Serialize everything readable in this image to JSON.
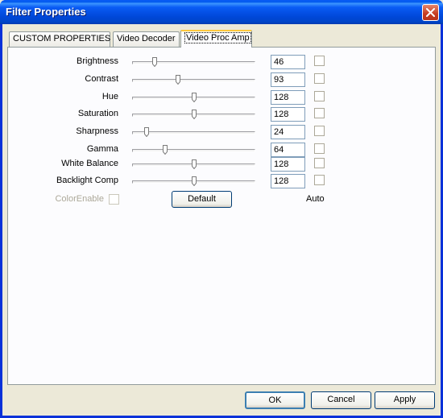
{
  "window": {
    "title": "Filter Properties"
  },
  "tabs": [
    {
      "label": "CUSTOM PROPERTIES",
      "active": false
    },
    {
      "label": "Video Decoder",
      "active": false
    },
    {
      "label": "Video Proc Amp",
      "active": true
    }
  ],
  "controls": [
    {
      "label": "Brightness",
      "value": "46",
      "slider_fraction": 0.17
    },
    {
      "label": "Contrast",
      "value": "93",
      "slider_fraction": 0.37
    },
    {
      "label": "Hue",
      "value": "128",
      "slider_fraction": 0.5
    },
    {
      "label": "Saturation",
      "value": "128",
      "slider_fraction": 0.5
    },
    {
      "label": "Sharpness",
      "value": "24",
      "slider_fraction": 0.1
    },
    {
      "label": "Gamma",
      "value": "64",
      "slider_fraction": 0.26
    },
    {
      "label": "White Balance",
      "value": "128",
      "slider_fraction": 0.5
    },
    {
      "label": "Backlight Comp",
      "value": "128",
      "slider_fraction": 0.5
    }
  ],
  "color_enable": {
    "label": "ColorEnable",
    "checked": false,
    "enabled": false
  },
  "default_button": "Default",
  "auto_label": "Auto",
  "footer": {
    "ok": "OK",
    "cancel": "Cancel",
    "apply": "Apply"
  },
  "icons": {
    "close": "close-icon"
  },
  "colors": {
    "titlebar": "#0054e3",
    "close": "#c53c1f",
    "dialog": "#ece9d8"
  }
}
